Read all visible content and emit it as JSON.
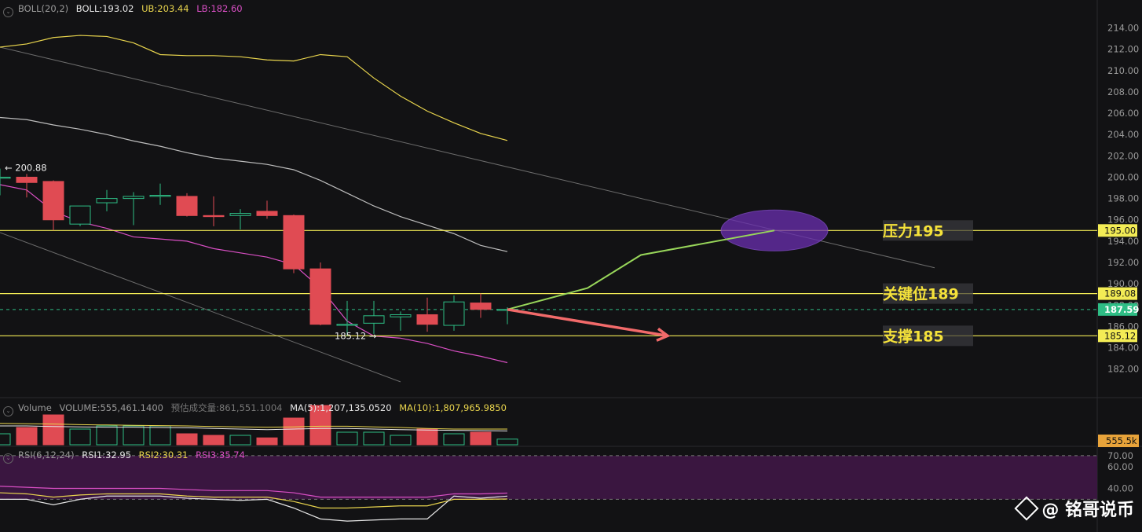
{
  "boll_header": {
    "label": "BOLL(20,2)",
    "boll": "BOLL:193.02",
    "ub": "UB:203.44",
    "lb": "LB:182.60"
  },
  "volume_header": {
    "label": "Volume",
    "volume": "VOLUME:555,461.1400",
    "est": "预估成交量:861,551.1004",
    "ma5": "MA(5):1,207,135.0520",
    "ma10": "MA(10):1,807,965.9850"
  },
  "rsi_header": {
    "label": "RSI(6,12,24)",
    "rsi1": "RSI1:32.95",
    "rsi2": "RSI2:30.31",
    "rsi3": "RSI3:35.74"
  },
  "colors": {
    "up": "#2ebd85",
    "down": "#e04b53",
    "ub": "#e8d44d",
    "mid": "#bdbdbd",
    "lb": "#d94fc4",
    "hline": "#f3ec55",
    "green_path": "#98d65a",
    "red_arrow": "#f26a6a",
    "ellipse": "#6a2fb0",
    "rsi_band": "#3a1640"
  },
  "chart_data": [
    {
      "type": "candlestick",
      "title": "BOLL(20,2)",
      "ylim": [
        180.5,
        215.0
      ],
      "y_ticks": [
        "214.00",
        "212.00",
        "210.00",
        "208.00",
        "206.00",
        "204.00",
        "202.00",
        "200.00",
        "198.00",
        "196.00",
        "194.00",
        "192.00",
        "190.00",
        "188.00",
        "186.00",
        "184.00",
        "182.00"
      ],
      "candles": [
        {
          "o": 199.9,
          "c": 200.0,
          "h": 200.8,
          "l": 198.3
        },
        {
          "o": 200.0,
          "c": 199.5,
          "h": 200.3,
          "l": 198.1
        },
        {
          "o": 199.6,
          "c": 196.0,
          "h": 199.7,
          "l": 195.0
        },
        {
          "o": 195.6,
          "c": 197.3,
          "h": 197.3,
          "l": 195.4
        },
        {
          "o": 197.6,
          "c": 198.0,
          "h": 198.8,
          "l": 196.8
        },
        {
          "o": 198.0,
          "c": 198.2,
          "h": 198.6,
          "l": 195.5
        },
        {
          "o": 198.2,
          "c": 198.3,
          "h": 199.4,
          "l": 197.4
        },
        {
          "o": 198.2,
          "c": 196.4,
          "h": 198.5,
          "l": 196.3
        },
        {
          "o": 196.4,
          "c": 196.3,
          "h": 198.2,
          "l": 195.4
        },
        {
          "o": 196.4,
          "c": 196.6,
          "h": 197.0,
          "l": 195.1
        },
        {
          "o": 196.8,
          "c": 196.4,
          "h": 197.8,
          "l": 196.1
        },
        {
          "o": 196.4,
          "c": 191.4,
          "h": 196.5,
          "l": 191.0
        },
        {
          "o": 191.4,
          "c": 186.2,
          "h": 192.0,
          "l": 186.1
        },
        {
          "o": 186.1,
          "c": 186.2,
          "h": 188.4,
          "l": 185.1
        },
        {
          "o": 186.3,
          "c": 187.0,
          "h": 188.4,
          "l": 185.3
        },
        {
          "o": 186.9,
          "c": 187.1,
          "h": 187.4,
          "l": 185.6
        },
        {
          "o": 187.1,
          "c": 186.2,
          "h": 188.7,
          "l": 185.5
        },
        {
          "o": 186.1,
          "c": 188.3,
          "h": 188.9,
          "l": 185.6
        },
        {
          "o": 188.2,
          "c": 187.6,
          "h": 189.1,
          "l": 186.8
        },
        {
          "o": 187.5,
          "c": 187.6,
          "h": 187.8,
          "l": 186.2
        }
      ],
      "ub": [
        212.2,
        212.5,
        213.1,
        213.3,
        213.2,
        212.6,
        211.5,
        211.4,
        211.4,
        211.3,
        211.0,
        210.9,
        211.5,
        211.3,
        209.3,
        207.6,
        206.2,
        205.1,
        204.1,
        203.44
      ],
      "mid": [
        205.6,
        205.4,
        204.9,
        204.5,
        204.0,
        203.4,
        202.9,
        202.3,
        201.8,
        201.5,
        201.2,
        200.7,
        199.7,
        198.5,
        197.3,
        196.3,
        195.5,
        194.7,
        193.6,
        193.02
      ],
      "lb": [
        199.3,
        198.8,
        196.8,
        195.8,
        195.2,
        194.4,
        194.2,
        194.0,
        193.3,
        192.9,
        192.5,
        191.8,
        189.6,
        186.5,
        185.1,
        184.9,
        184.4,
        183.7,
        183.2,
        182.6
      ],
      "trend_lines": [
        {
          "from": [
            0,
            212.2
          ],
          "to": [
            35,
            191.5
          ]
        },
        {
          "from": [
            0,
            194.8
          ],
          "to": [
            15,
            180.8
          ]
        }
      ],
      "price_levels": [
        {
          "value": 195.0,
          "label": "压力195",
          "tag": "195.00"
        },
        {
          "value": 189.08,
          "label": "关键位189",
          "tag": "189.08"
        },
        {
          "value": 185.12,
          "label": "支撑185",
          "tag": "185.12"
        }
      ],
      "current_price": "187.59",
      "current_value": 187.59,
      "annotations": {
        "high": "200.88",
        "low": "185.12"
      },
      "projection_up": [
        [
          19,
          187.59
        ],
        [
          22,
          189.6
        ],
        [
          24,
          192.7
        ],
        [
          29,
          195.0
        ]
      ],
      "projection_down": [
        [
          19,
          187.59
        ],
        [
          25,
          185.12
        ]
      ],
      "target_zone": {
        "x": 29,
        "y": 195.0
      }
    },
    {
      "type": "bar",
      "title": "Volume",
      "current_tag": "555.5k",
      "values": [
        0.35,
        0.55,
        0.95,
        0.5,
        0.6,
        0.6,
        0.6,
        0.35,
        0.3,
        0.3,
        0.22,
        0.85,
        1.25,
        0.4,
        0.4,
        0.3,
        0.5,
        0.35,
        0.4,
        0.18
      ],
      "ma5": [
        0.6,
        0.6,
        0.58,
        0.57,
        0.56,
        0.56,
        0.55,
        0.54,
        0.52,
        0.5,
        0.48,
        0.5,
        0.52,
        0.52,
        0.5,
        0.48,
        0.47,
        0.46,
        0.45,
        0.44
      ],
      "ma10": [
        0.68,
        0.67,
        0.66,
        0.64,
        0.63,
        0.62,
        0.61,
        0.6,
        0.58,
        0.57,
        0.56,
        0.57,
        0.59,
        0.59,
        0.57,
        0.55,
        0.52,
        0.5,
        0.5,
        0.5
      ]
    },
    {
      "type": "line",
      "title": "RSI(6,12,24)",
      "ylim": [
        0,
        75
      ],
      "y_ticks": [
        "70.00",
        "60.00",
        "40.00"
      ],
      "band": [
        30,
        70
      ],
      "rsi1": [
        30,
        30,
        25,
        30,
        33,
        33,
        33,
        31,
        30,
        29,
        30,
        22,
        12,
        10,
        11,
        12,
        12,
        33,
        31,
        32.95
      ],
      "rsi2": [
        36,
        35,
        32,
        34,
        35,
        35,
        35,
        33,
        32,
        32,
        32,
        28,
        22,
        22,
        23,
        24,
        24,
        30,
        30,
        30.31
      ],
      "rsi3": [
        42,
        41,
        40,
        40,
        40,
        40,
        40,
        39,
        38,
        38,
        38,
        36,
        32,
        32,
        32,
        32,
        32,
        35,
        35,
        35.74
      ]
    }
  ],
  "watermark": "@ 铭哥说币"
}
